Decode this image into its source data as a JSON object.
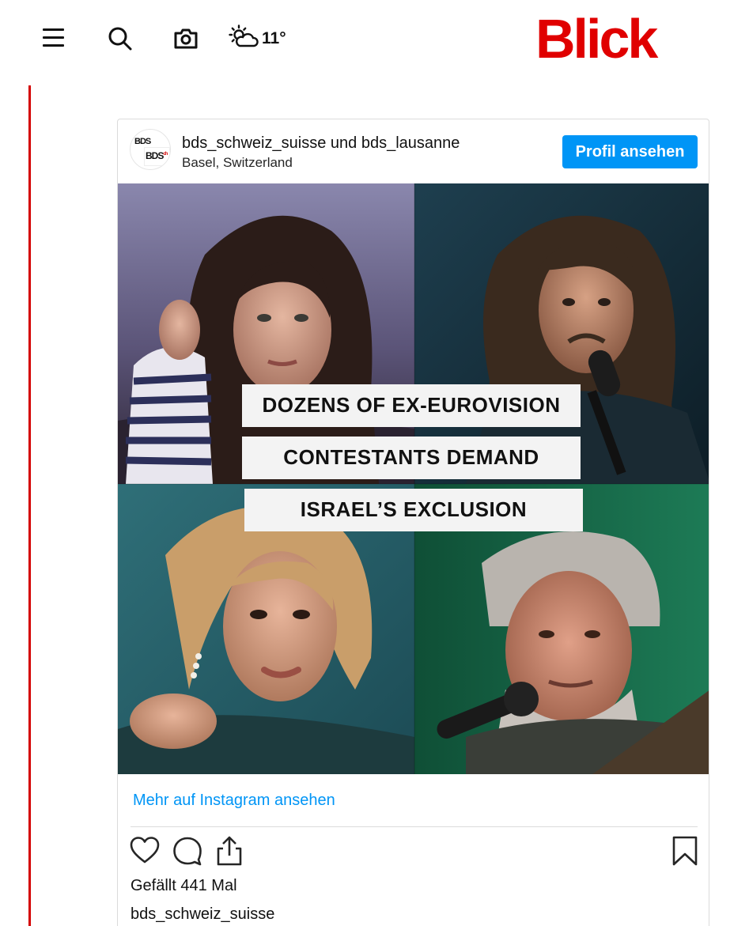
{
  "header": {
    "menu_icon": "hamburger-menu-icon",
    "search_icon": "search-icon",
    "camera_icon": "camera-icon",
    "weather": {
      "icon": "sun-cloud-icon",
      "temperature": "11°"
    },
    "logo_text": "Blick",
    "brand_color": "#e00000"
  },
  "instagram_embed": {
    "account_primary": "bds_schweiz_suisse",
    "connector": "und",
    "account_secondary": "bds_lausanne",
    "location": "Basel, Switzerland",
    "avatar_text_top": "BDS",
    "avatar_text_bottom": "BDS",
    "avatar_text_suffix": "ch",
    "profile_button_label": "Profil ansehen",
    "image": {
      "banner_lines": [
        "DOZENS OF EX-EUROVISION",
        "CONTESTANTS DEMAND",
        "ISRAEL’S EXCLUSION"
      ]
    },
    "more_link": "Mehr auf Instagram ansehen",
    "actions": {
      "like_icon": "heart-icon",
      "comment_icon": "comment-icon",
      "share_icon": "share-icon",
      "save_icon": "bookmark-icon"
    },
    "likes_text": "Gefällt 441 Mal",
    "caption_user": "bds_schweiz_suisse",
    "accent_color": "#0095f6"
  }
}
